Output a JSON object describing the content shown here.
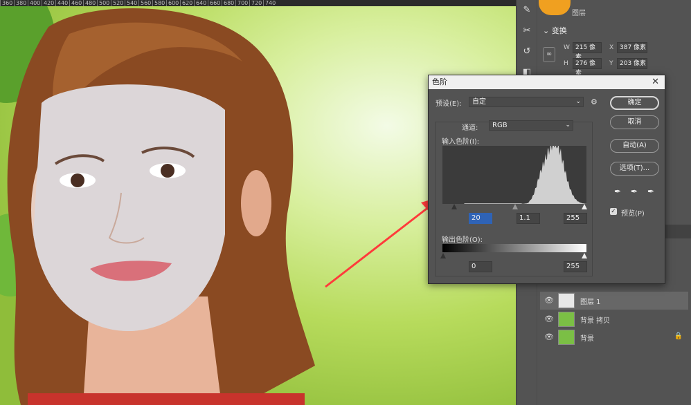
{
  "ruler": {
    "ticks": [
      "360",
      "380",
      "400",
      "420",
      "440",
      "460",
      "480",
      "500",
      "520",
      "540",
      "560",
      "580",
      "600",
      "620",
      "640",
      "660",
      "680",
      "700",
      "720",
      "740"
    ]
  },
  "properties_panel": {
    "panel_tab": "图层",
    "section": "变换",
    "w_label": "W",
    "w_value": "215 像素",
    "x_label": "X",
    "x_value": "387 像素",
    "h_label": "H",
    "h_value": "276 像素",
    "y_label": "Y",
    "y_value": "203 像素"
  },
  "layers": [
    {
      "name": "图层 1",
      "selected": true,
      "locked": false
    },
    {
      "name": "背景 拷贝",
      "selected": false,
      "locked": false
    },
    {
      "name": "背景",
      "selected": false,
      "locked": true
    }
  ],
  "dialog": {
    "title": "色阶",
    "close_glyph": "✕",
    "preset_label": "预设(E):",
    "preset_value": "自定",
    "channel_label": "通道:",
    "channel_value": "RGB",
    "input_levels_label": "输入色阶(I):",
    "input_black": "20",
    "input_gamma": "1.1",
    "input_white": "255",
    "output_levels_label": "输出色阶(O):",
    "output_black": "0",
    "output_white": "255",
    "buttons": {
      "ok": "确定",
      "cancel": "取消",
      "auto": "自动(A)",
      "options": "选项(T)..."
    },
    "preview_label": "预览(P)",
    "preview_checked": true
  },
  "colors": {
    "arrow": "#ff3b3b",
    "accent_selected": "#2f63b6",
    "panel_bg": "#535353"
  }
}
